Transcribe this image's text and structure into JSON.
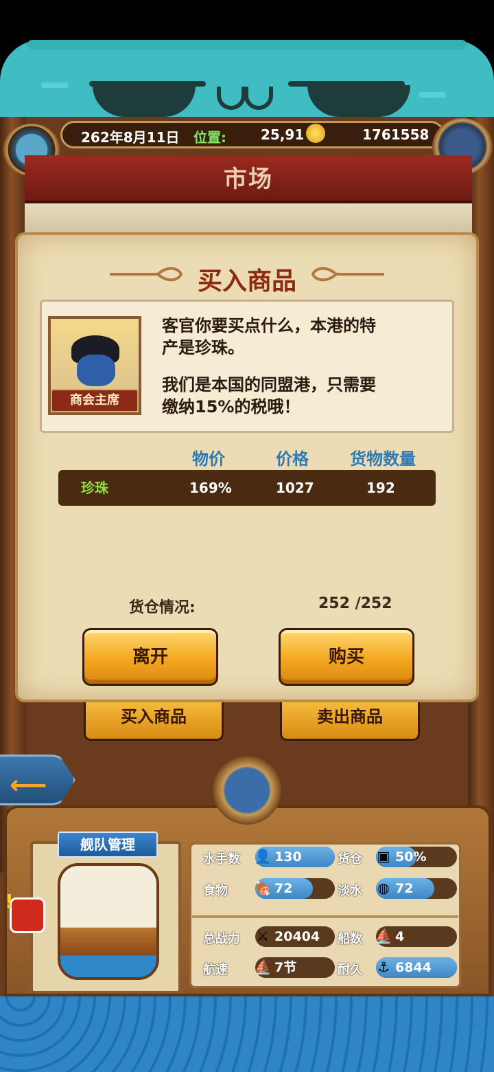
{
  "hud": {
    "date": "262年8月11日",
    "location_label": "位置:",
    "location_value": "25,91",
    "gold": "1761558"
  },
  "screen_title": "市场",
  "dialog": {
    "title": "买入商品",
    "npc_role": "商会主席",
    "message_line1": "客官你要买点什么，本港的特",
    "message_line2": "产是珍珠。",
    "message_line3": "我们是本国的同盟港，只需要",
    "message_line4": "缴纳15%的税哦！",
    "columns": [
      "物价",
      "价格",
      "货物数量"
    ],
    "rows": [
      {
        "name": "珍珠",
        "index": "169%",
        "price": "1027",
        "qty": "192"
      }
    ],
    "cargo_label": "货仓情况:",
    "cargo_value": "252 /252",
    "leave_button": "离开",
    "buy_button": "购买"
  },
  "market_tabs": {
    "buy": "买入商品",
    "sell": "卖出商品"
  },
  "fleet": {
    "title": "舰队管理",
    "stats": [
      {
        "label": "水手数",
        "value": "130",
        "icon": "sailor-icon",
        "fill": 1.0
      },
      {
        "label": "货仓",
        "value": "50%",
        "icon": "crate-icon",
        "fill": 0.5
      },
      {
        "label": "食物",
        "value": "72",
        "icon": "meat-icon",
        "fill": 0.72
      },
      {
        "label": "淡水",
        "value": "72",
        "icon": "water-jug-icon",
        "fill": 0.72
      },
      {
        "label": "总战力",
        "value": "20404",
        "icon": "crossed-swords-icon",
        "fill": 0
      },
      {
        "label": "船数",
        "value": "4",
        "icon": "boat-icon",
        "fill": 0
      },
      {
        "label": "航速",
        "value": "7节",
        "icon": "sail-ship-icon",
        "fill": 0
      },
      {
        "label": "耐久",
        "value": "6844",
        "icon": "repair-ship-icon",
        "fill": 1.0
      }
    ]
  },
  "colors": {
    "accent_blue": "#3f86c4",
    "button_orange": "#f3a71f",
    "title_red": "#8a2a10",
    "cat_teal": "#3fbdc2"
  }
}
